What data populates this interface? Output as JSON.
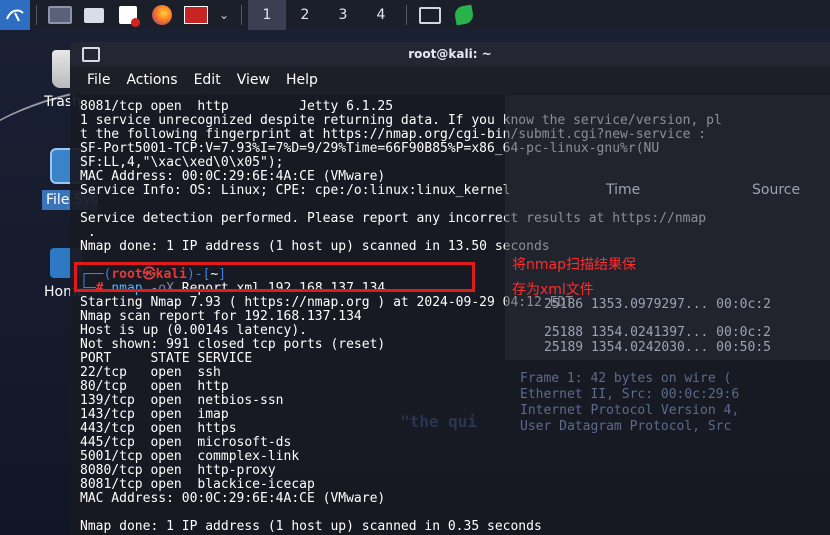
{
  "taskbar": {
    "workspaces": [
      "1",
      "2",
      "3",
      "4"
    ],
    "active_workspace": "1",
    "chevron": "⌄",
    "icons": [
      "kali-menu-icon",
      "terminal-icon",
      "files-icon",
      "text-editor-icon",
      "firefox-icon",
      "root-terminal-icon",
      "terminal-icon",
      "kali-leaf-icon"
    ]
  },
  "desktop": {
    "icons": [
      {
        "name": "trash",
        "label": "Trash"
      },
      {
        "name": "file-system",
        "label": "File System"
      },
      {
        "name": "home",
        "label": "Home"
      }
    ]
  },
  "background_window": {
    "rows_header": [
      "Time",
      "Source"
    ],
    "rows": [
      "25186 1353.0979297... 00:0c:2",
      "25188 1354.0241397... 00:0c:2",
      "25189 1354.0242030... 00:50:5"
    ],
    "details": [
      "Frame 1: 42 bytes on wire (",
      "Ethernet II, Src: 00:0c:29:6",
      "Internet Protocol Version 4,",
      "User Datagram Protocol, Src "
    ],
    "watermark": "\"the qui"
  },
  "terminal": {
    "title": "root@kali: ~",
    "menu": [
      "File",
      "Actions",
      "Edit",
      "View",
      "Help"
    ],
    "output_top": [
      "8081/tcp open  http         Jetty 6.1.25",
      "1 service unrecognized despite returning data. If you know the service/version, pl",
      "t the following fingerprint at https://nmap.org/cgi-bin/submit.cgi?new-service :",
      "SF-Port5001-TCP:V=7.93%I=7%D=9/29%Time=66F90B85%P=x86_64-pc-linux-gnu%r(NU",
      "SF:LL,4,\"\\xac\\xed\\0\\x05\");",
      "MAC Address: 00:0C:29:6E:4A:CE (VMware)",
      "Service Info: OS: Linux; CPE: cpe:/o:linux:linux_kernel",
      "",
      "Service detection performed. Please report any incorrect results at https://nmap",
      " .",
      "Nmap done: 1 IP address (1 host up) scanned in 13.50 seconds",
      ""
    ],
    "prompt": {
      "open": "┌──(",
      "user": "root㉿kali",
      "mid": ")-[",
      "dir": "~",
      "close": "]",
      "second": "└─",
      "hash": "# ",
      "cmd": "nmap",
      "flag": " -oX ",
      "args": "Report.xml 192.168.137.134"
    },
    "output_bottom": [
      "Starting Nmap 7.93 ( https://nmap.org ) at 2024-09-29 04:12 EDT",
      "Nmap scan report for 192.168.137.134",
      "Host is up (0.0014s latency).",
      "Not shown: 991 closed tcp ports (reset)",
      "PORT     STATE SERVICE",
      "22/tcp   open  ssh",
      "80/tcp   open  http",
      "139/tcp  open  netbios-ssn",
      "143/tcp  open  imap",
      "443/tcp  open  https",
      "445/tcp  open  microsoft-ds",
      "5001/tcp open  commplex-link",
      "8080/tcp open  http-proxy",
      "8081/tcp open  blackice-icecap",
      "MAC Address: 00:0C:29:6E:4A:CE (VMware)",
      "",
      "Nmap done: 1 IP address (1 host up) scanned in 0.35 seconds"
    ]
  },
  "annotation": {
    "line1": "将nmap扫描结果保",
    "line2": "存为xml文件"
  },
  "colors": {
    "highlight_box": "#e01b1b",
    "annotation_text": "#ff2d2d",
    "prompt_user": "#e23a3a",
    "prompt_frame": "#3f7de0"
  }
}
